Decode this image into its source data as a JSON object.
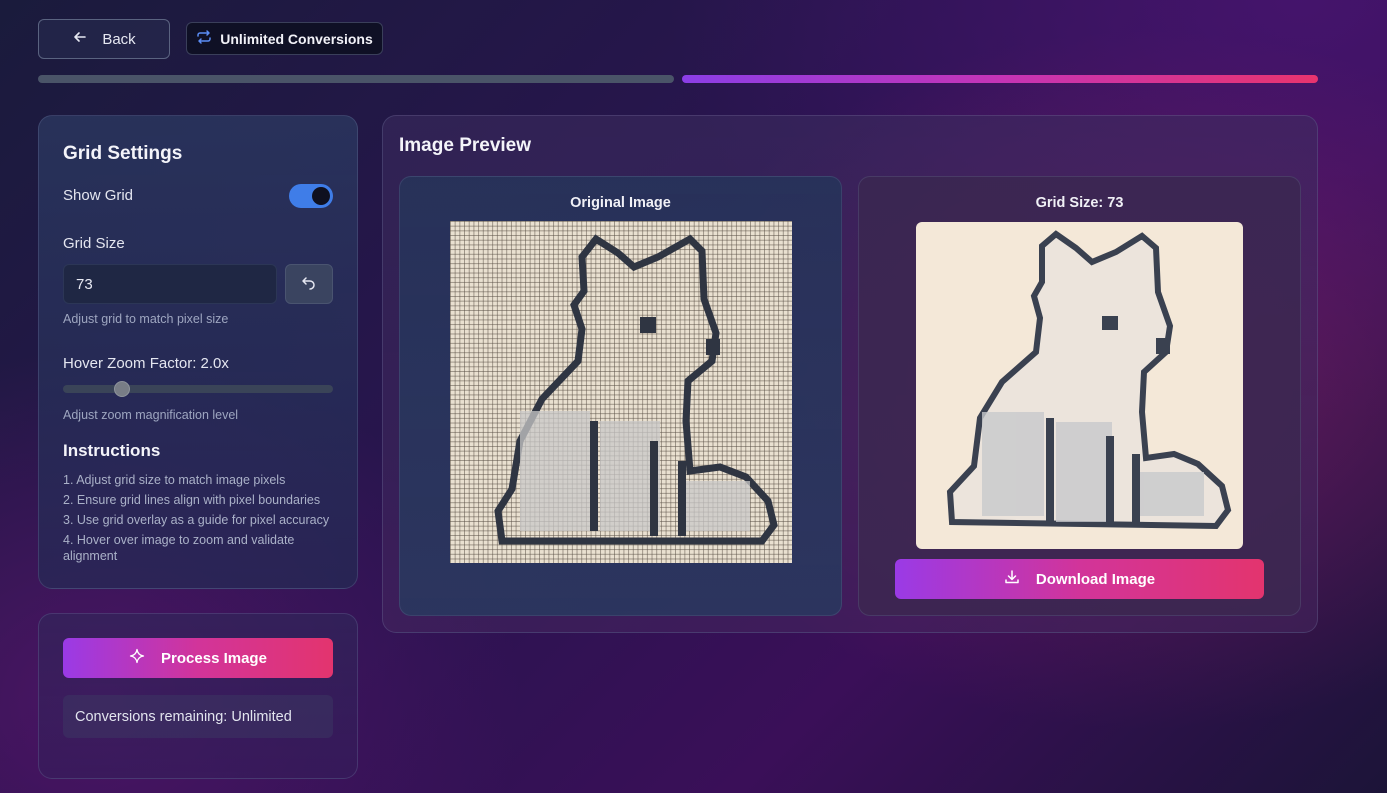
{
  "header": {
    "back_label": "Back",
    "badge_label": "Unlimited Conversions",
    "progress_fraction": 1.0
  },
  "settings": {
    "title": "Grid Settings",
    "show_grid_label": "Show Grid",
    "show_grid_on": true,
    "grid_size_label": "Grid Size",
    "grid_size_value": "73",
    "grid_size_hint": "Adjust grid to match pixel size",
    "zoom_label": "Hover Zoom Factor: 2.0x",
    "zoom_value": 2.0,
    "zoom_hint": "Adjust zoom magnification level",
    "instructions_title": "Instructions",
    "instructions": [
      "1. Adjust grid size to match image pixels",
      "2. Ensure grid lines align with pixel boundaries",
      "3. Use grid overlay as a guide for pixel accuracy",
      "4. Hover over image to zoom and validate alignment"
    ]
  },
  "process": {
    "button_label": "Process Image",
    "remaining_text": "Conversions remaining: Unlimited"
  },
  "preview": {
    "title": "Image Preview",
    "original_title": "Original Image",
    "grid_title": "Grid Size: 73",
    "download_label": "Download Image"
  },
  "icons": {
    "back": "arrow-left-icon",
    "badge": "repeat-icon",
    "reset": "undo-icon",
    "process": "sparkle-icon",
    "download": "download-icon"
  },
  "colors": {
    "accent_start": "#9a3ae6",
    "accent_end": "#e3346e",
    "toggle_on": "#3f7de8"
  }
}
